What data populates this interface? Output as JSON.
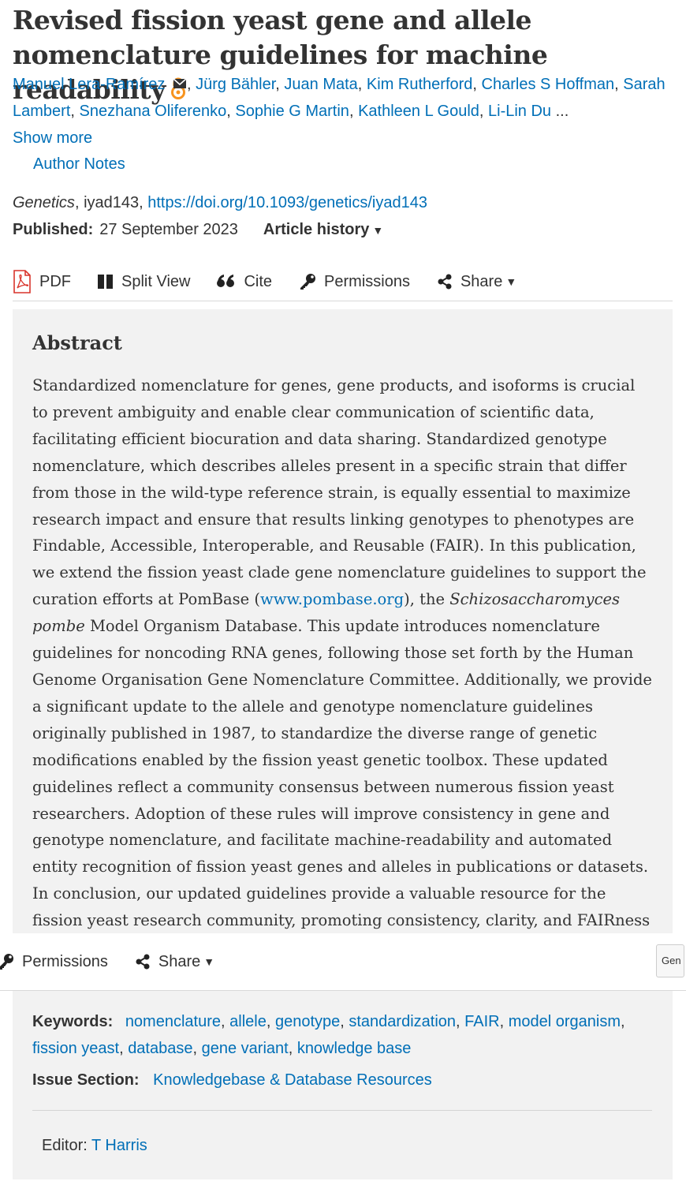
{
  "article": {
    "title": "Revised fission yeast gene and allele nomenclature guidelines for machine readability",
    "authors": [
      "Manuel Lera-Ramírez",
      "Jürg Bähler",
      "Juan Mata",
      "Kim Rutherford",
      "Charles S Hoffman",
      "Sarah Lambert",
      "Snezhana Oliferenko",
      "Sophie G Martin",
      "Kathleen L Gould",
      "Li-Lin Du"
    ],
    "authors_ellipsis": "...",
    "show_more": "Show more",
    "author_notes": "Author Notes",
    "journal": "Genetics",
    "article_id": "iyad143",
    "doi": "https://doi.org/10.1093/genetics/iyad143",
    "published_label": "Published:",
    "published_date": "27 September 2023",
    "article_history": "Article history"
  },
  "toolbar": {
    "pdf": "PDF",
    "split_view": "Split View",
    "cite": "Cite",
    "permissions": "Permissions",
    "share": "Share"
  },
  "abstract": {
    "heading": "Abstract",
    "part1": "Standardized nomenclature for genes, gene products, and isoforms is crucial to prevent ambiguity and enable clear communication of scientific data, facilitating efficient biocuration and data sharing. Standardized genotype nomenclature, which describes alleles present in a specific strain that differ from those in the wild-type reference strain, is equally essential to maximize research impact and ensure that results linking genotypes to phenotypes are Findable, Accessible, Interoperable, and Reusable (FAIR). In this publication, we extend the fission yeast clade gene nomenclature guidelines to support the curation efforts at PomBase (",
    "link": "www.pombase.org",
    "part2": "), the ",
    "species": "Schizosaccharomyces pombe",
    "part3": " Model Organism Database. This update introduces nomenclature guidelines for noncoding RNA genes, following those set forth by the Human Genome Organisation Gene Nomenclature Committee. Additionally, we provide a significant update to the allele and genotype nomenclature guidelines originally published in 1987, to standardize the diverse range of genetic modifications enabled by the fission yeast genetic toolbox. These updated guidelines reflect a community consensus between numerous fission yeast researchers. Adoption of these rules will improve consistency in gene and genotype nomenclature, and facilitate machine-readability and automated entity recognition of fission yeast genes and alleles in publications or datasets. In conclusion, our updated guidelines provide a valuable resource for the fission yeast research community, promoting consistency, clarity, and FAIRness in"
  },
  "sticky_toolbar": {
    "permissions": "Permissions",
    "share": "Share",
    "journal_select": "Gen"
  },
  "keywords": {
    "label": "Keywords:",
    "items": [
      "nomenclature",
      "allele",
      "genotype",
      "standardization",
      "FAIR",
      "model organism",
      "fission yeast",
      "database",
      "gene variant",
      "knowledge base"
    ]
  },
  "issue_section": {
    "label": "Issue Section:",
    "value": "Knowledgebase & Database Resources"
  },
  "editor": {
    "label": "Editor:",
    "name": "T Harris"
  },
  "colors": {
    "link": "#006fb7",
    "pdf_red": "#d9342b",
    "open_access": "#f7931e",
    "abstract_bg": "#f2f2f2"
  }
}
